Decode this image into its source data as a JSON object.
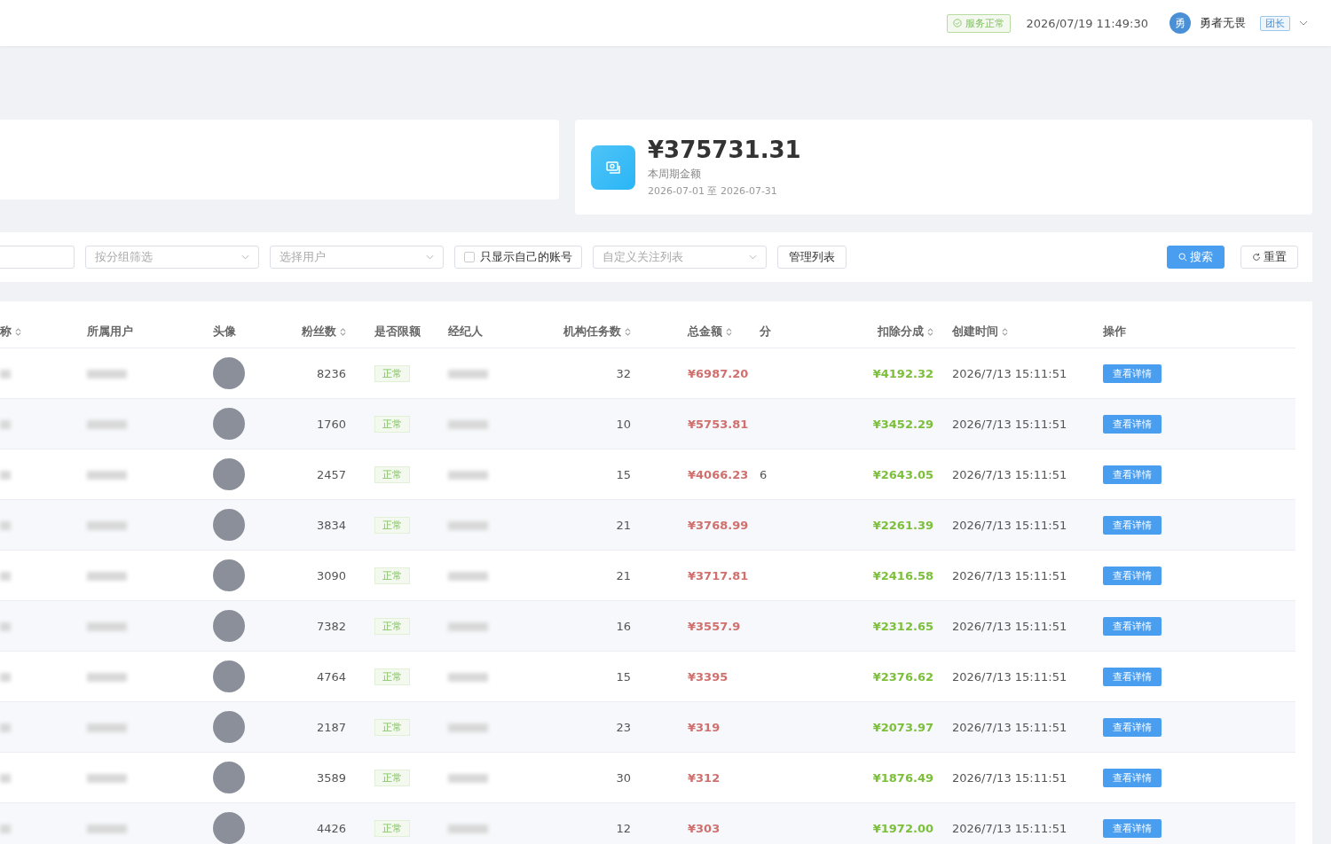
{
  "header": {
    "service_status": "服务正常",
    "datetime": "2026/07/19 11:49:30",
    "user": {
      "avatar_text": "勇",
      "name": "勇者无畏",
      "role": "团长"
    }
  },
  "summary": {
    "amount": "¥375731.31",
    "label": "本周期金额",
    "period": "2026-07-01 至 2026-07-31"
  },
  "filters": {
    "group_select": {
      "placeholder": "按分组筛选"
    },
    "user_select": {
      "placeholder": "选择用户"
    },
    "own_only": {
      "label": "只显示自己的账号",
      "checked": false
    },
    "watch_list": {
      "placeholder": "自定义关注列表"
    },
    "manage_button": "管理列表",
    "search_button": "搜索",
    "reset_button": "重置"
  },
  "table": {
    "columns": [
      {
        "label": "称",
        "sortable": true
      },
      {
        "label": "所属用户",
        "sortable": false
      },
      {
        "label": "头像",
        "sortable": false
      },
      {
        "label": "粉丝数",
        "sortable": true
      },
      {
        "label": "是否限额",
        "sortable": false
      },
      {
        "label": "经纪人",
        "sortable": false
      },
      {
        "label": "机构任务数",
        "sortable": true
      },
      {
        "label": "总金额",
        "sortable": true
      },
      {
        "label": "分",
        "sortable": false
      },
      {
        "label": "扣除分成",
        "sortable": true
      },
      {
        "label": "创建时间",
        "sortable": true
      },
      {
        "label": "操作",
        "sortable": false
      }
    ],
    "rows": [
      {
        "fans": "8236",
        "limit": "正常",
        "tasks": "32",
        "total": "¥6987.20",
        "deduct": "¥4192.32",
        "created": "2026/7/13 15:11:51",
        "action": "查看详情"
      },
      {
        "fans": "1760",
        "limit": "正常",
        "tasks": "10",
        "total": "¥5753.81",
        "deduct": "¥3452.29",
        "created": "2026/7/13 15:11:51",
        "action": "查看详情"
      },
      {
        "fans": "2457",
        "limit": "正常",
        "tasks": "15",
        "total": "¥4066.23",
        "share": "6",
        "deduct": "¥2643.05",
        "created": "2026/7/13 15:11:51",
        "action": "查看详情"
      },
      {
        "fans": "3834",
        "limit": "正常",
        "tasks": "21",
        "total": "¥3768.99",
        "deduct": "¥2261.39",
        "created": "2026/7/13 15:11:51",
        "action": "查看详情"
      },
      {
        "fans": "3090",
        "limit": "正常",
        "tasks": "21",
        "total": "¥3717.81",
        "deduct": "¥2416.58",
        "created": "2026/7/13 15:11:51",
        "action": "查看详情"
      },
      {
        "fans": "7382",
        "limit": "正常",
        "tasks": "16",
        "total": "¥3557.9",
        "deduct": "¥2312.65",
        "created": "2026/7/13 15:11:51",
        "action": "查看详情"
      },
      {
        "fans": "4764",
        "limit": "正常",
        "tasks": "15",
        "total": "¥3395",
        "deduct": "¥2376.62",
        "created": "2026/7/13 15:11:51",
        "action": "查看详情"
      },
      {
        "fans": "2187",
        "limit": "正常",
        "tasks": "23",
        "total": "¥319",
        "deduct": "¥2073.97",
        "created": "2026/7/13 15:11:51",
        "action": "查看详情"
      },
      {
        "fans": "3589",
        "limit": "正常",
        "tasks": "30",
        "total": "¥312",
        "deduct": "¥1876.49",
        "created": "2026/7/13 15:11:51",
        "action": "查看详情"
      },
      {
        "fans": "4426",
        "limit": "正常",
        "tasks": "12",
        "total": "¥303",
        "deduct": "¥1972.00",
        "created": "2026/7/13 15:11:51",
        "action": "查看详情"
      }
    ]
  }
}
